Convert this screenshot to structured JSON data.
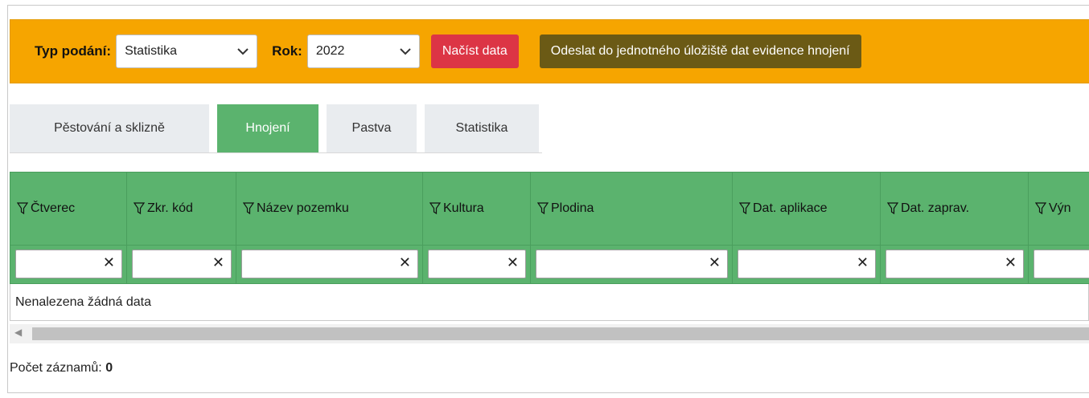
{
  "toolbar": {
    "type_label": "Typ podání:",
    "type_value": "Statistika",
    "year_label": "Rok:",
    "year_value": "2022",
    "load_button": "Načíst data",
    "send_button": "Odeslat do jednotného úložiště dat evidence hnojení",
    "colors": {
      "background": "#f6a500",
      "load": "#dc3545",
      "send": "#6b5a15"
    }
  },
  "tabs": [
    {
      "label": "Pěstování a sklizně",
      "active": false
    },
    {
      "label": "Hnojení",
      "active": true
    },
    {
      "label": "Pastva",
      "active": false
    },
    {
      "label": "Statistika",
      "active": false
    }
  ],
  "grid": {
    "header_color": "#5bb36e",
    "columns": [
      "Čtverec",
      "Zkr. kód",
      "Název pozemku",
      "Kultura",
      "Plodina",
      "Dat. aplikace",
      "Dat. zaprav.",
      "Výn"
    ],
    "no_data_text": "Nenalezena žádná data"
  },
  "footer": {
    "count_label": "Počet záznamů:",
    "count_value": "0"
  },
  "icons": {
    "filter": "filter-funnel-icon",
    "clear": "clear-x-icon",
    "dropdown": "chevron-down-icon"
  }
}
